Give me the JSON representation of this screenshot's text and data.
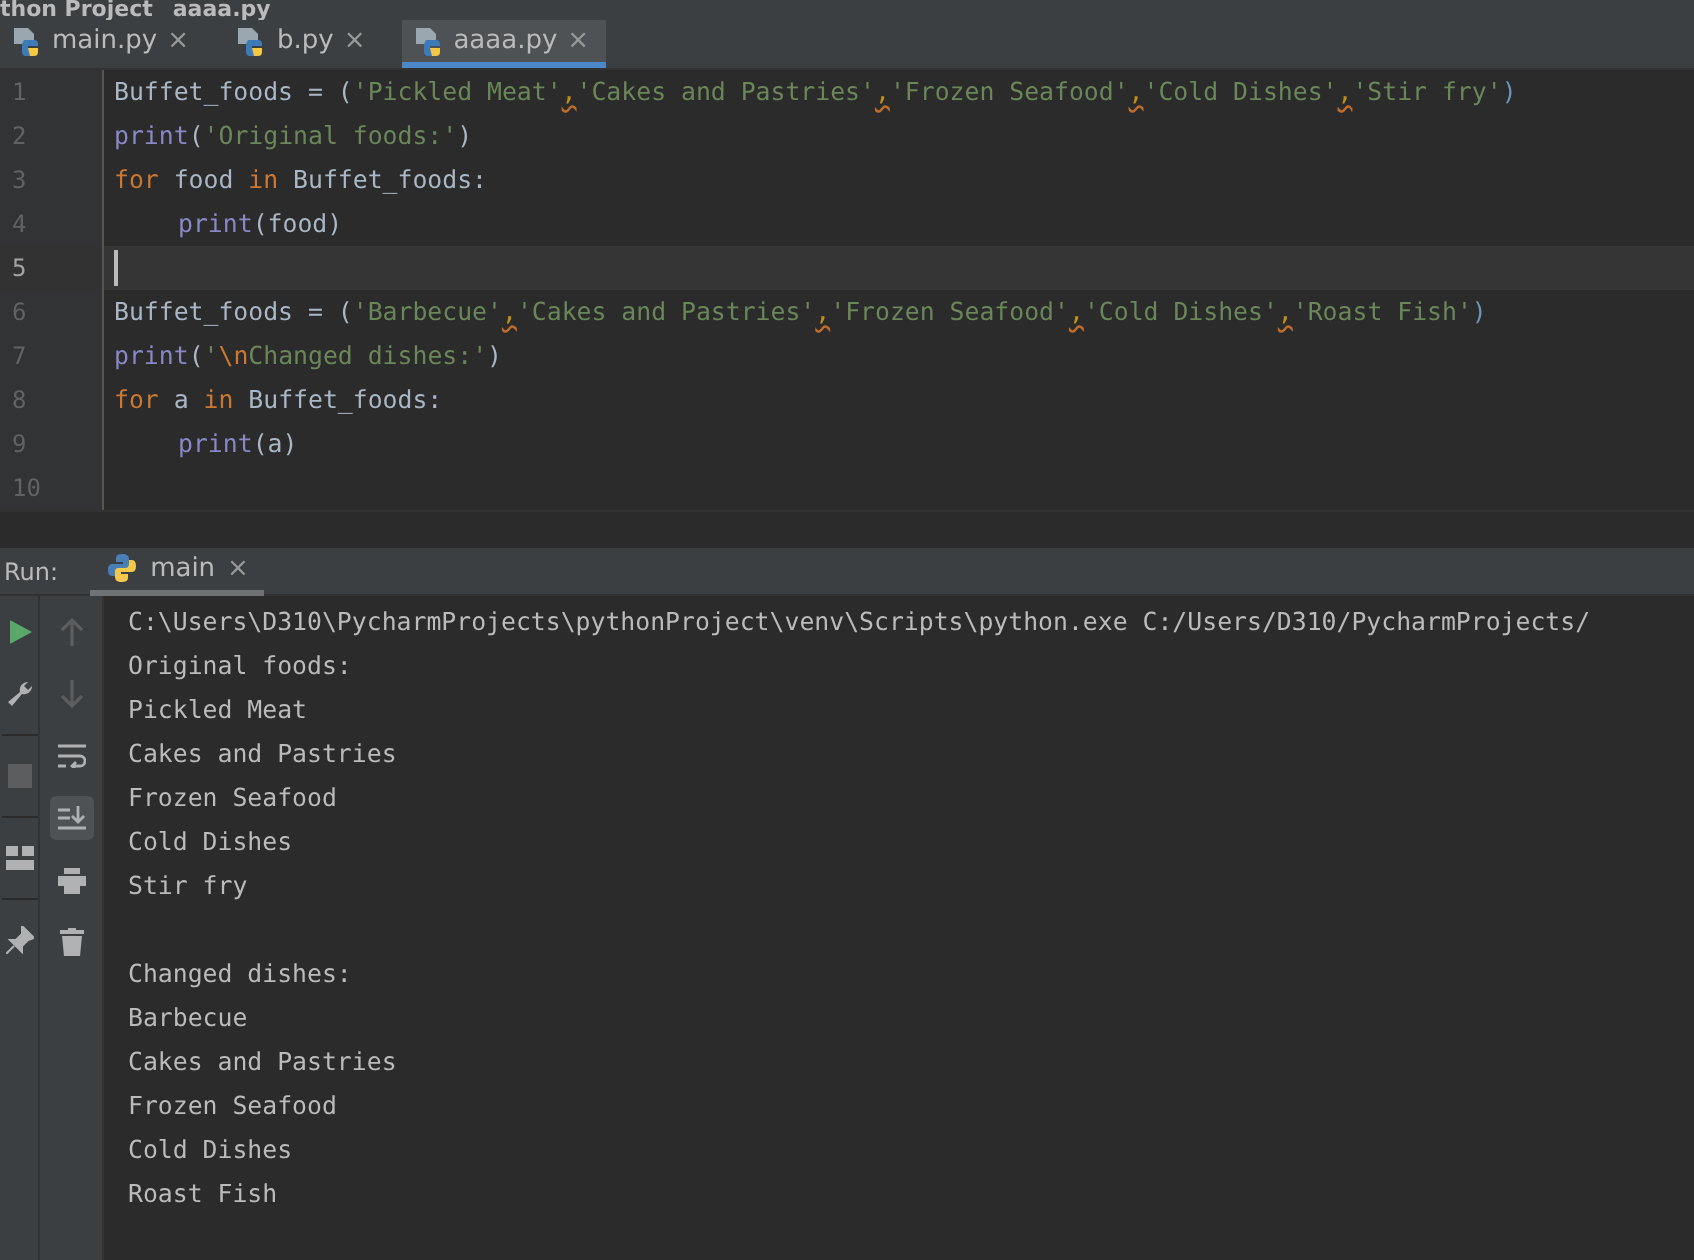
{
  "breadcrumb": [
    "thon Project",
    "aaaa.py"
  ],
  "tabs": [
    {
      "label": "main.py",
      "close": "×",
      "selected": false
    },
    {
      "label": "b.py",
      "close": "×",
      "selected": false
    },
    {
      "label": "aaaa.py",
      "close": "×",
      "selected": true
    }
  ],
  "editor": {
    "lines": [
      {
        "number": "1",
        "current": false,
        "tokens": [
          {
            "kind": "plain",
            "text": "Buffet_foods = ("
          },
          {
            "kind": "string",
            "text": "'Pickled Meat'"
          },
          {
            "kind": "warn",
            "text": ","
          },
          {
            "kind": "string",
            "text": "'Cakes and Pastries'"
          },
          {
            "kind": "warn",
            "text": ","
          },
          {
            "kind": "string",
            "text": "'Frozen Seafood'"
          },
          {
            "kind": "warn",
            "text": ","
          },
          {
            "kind": "string",
            "text": "'Cold Dishes'"
          },
          {
            "kind": "warn",
            "text": ","
          },
          {
            "kind": "string",
            "text": "'Stir fry'"
          },
          {
            "kind": "paren",
            "text": ")"
          }
        ]
      },
      {
        "number": "2",
        "current": false,
        "tokens": [
          {
            "kind": "builtin",
            "text": "print"
          },
          {
            "kind": "plain",
            "text": "("
          },
          {
            "kind": "string",
            "text": "'Original foods:'"
          },
          {
            "kind": "plain",
            "text": ")"
          }
        ]
      },
      {
        "number": "3",
        "current": false,
        "tokens": [
          {
            "kind": "keyword",
            "text": "for"
          },
          {
            "kind": "plain",
            "text": " food "
          },
          {
            "kind": "keyword",
            "text": "in"
          },
          {
            "kind": "plain",
            "text": " Buffet_foods:"
          }
        ]
      },
      {
        "number": "4",
        "current": false,
        "indented": true,
        "tokens": [
          {
            "kind": "builtin",
            "text": "print"
          },
          {
            "kind": "plain",
            "text": "(food)"
          }
        ]
      },
      {
        "number": "5",
        "current": true
      },
      {
        "number": "6",
        "current": false,
        "tokens": [
          {
            "kind": "plain",
            "text": "Buffet_foods = ("
          },
          {
            "kind": "string",
            "text": "'Barbecue'"
          },
          {
            "kind": "warn",
            "text": ","
          },
          {
            "kind": "string",
            "text": "'Cakes and Pastries'"
          },
          {
            "kind": "warn",
            "text": ","
          },
          {
            "kind": "string",
            "text": "'Frozen Seafood'"
          },
          {
            "kind": "warn",
            "text": ","
          },
          {
            "kind": "string",
            "text": "'Cold Dishes'"
          },
          {
            "kind": "warn",
            "text": ","
          },
          {
            "kind": "string",
            "text": "'Roast Fish'"
          },
          {
            "kind": "paren",
            "text": ")"
          }
        ]
      },
      {
        "number": "7",
        "current": false,
        "tokens": [
          {
            "kind": "builtin",
            "text": "print"
          },
          {
            "kind": "plain",
            "text": "("
          },
          {
            "kind": "string",
            "text": "'"
          },
          {
            "kind": "escape",
            "text": "\\n"
          },
          {
            "kind": "string",
            "text": "Changed dishes:'"
          },
          {
            "kind": "plain",
            "text": ")"
          }
        ]
      },
      {
        "number": "8",
        "current": false,
        "tokens": [
          {
            "kind": "keyword",
            "text": "for"
          },
          {
            "kind": "plain",
            "text": " a "
          },
          {
            "kind": "keyword",
            "text": "in"
          },
          {
            "kind": "plain",
            "text": " Buffet_foods:"
          }
        ]
      },
      {
        "number": "9",
        "current": false,
        "indented": true,
        "tokens": [
          {
            "kind": "builtin",
            "text": "print"
          },
          {
            "kind": "plain",
            "text": "(a)"
          }
        ]
      },
      {
        "number": "10",
        "current": false
      }
    ]
  },
  "run_panel": {
    "label": "Run:",
    "tab": {
      "label": "main",
      "close": "×",
      "selected": true
    },
    "output_blocks": [
      {
        "lines": [
          "C:\\Users\\D310\\PycharmProjects\\pythonProject\\venv\\Scripts\\python.exe C:/Users/D310/PycharmProjects/",
          "Original foods:",
          "Pickled Meat",
          "Cakes and Pastries",
          "Frozen Seafood",
          "Cold Dishes",
          "Stir fry"
        ]
      },
      {
        "lines": [
          "Changed dishes:",
          "Barbecue",
          "Cakes and Pastries",
          "Frozen Seafood",
          "Cold Dishes",
          "Roast Fish"
        ]
      }
    ]
  }
}
